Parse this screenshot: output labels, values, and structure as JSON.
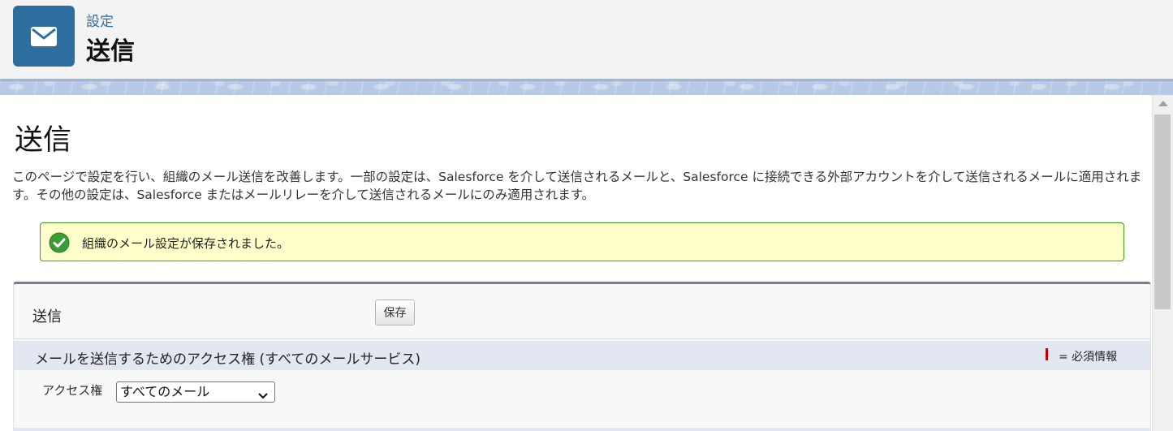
{
  "header": {
    "breadcrumb": "設定",
    "title": "送信",
    "icon": "envelope-icon",
    "icon_bg": "#2d6e9f"
  },
  "main": {
    "title": "送信",
    "description": "このページで設定を行い、組織のメール送信を改善します。一部の設定は、Salesforce を介して送信されるメールと、Salesforce に接続できる外部アカウントを介して送信されるメールに適用されます。その他の設定は、Salesforce またはメールリレーを介して送信されるメールにのみ適用されます。",
    "message": {
      "icon": "success-check-icon",
      "text": "組織のメール設定が保存されました。",
      "bg_color": "#ffffcc",
      "border_color": "#39a025"
    },
    "block": {
      "title": "送信",
      "save_label": "保存",
      "section": {
        "title": "メールを送信するためのアクセス権 (すべてのメールサービス)",
        "required_legend": "= 必須情報",
        "required_color": "#c00000"
      },
      "field": {
        "label": "アクセス権",
        "selected_value": "すべてのメール"
      }
    }
  }
}
